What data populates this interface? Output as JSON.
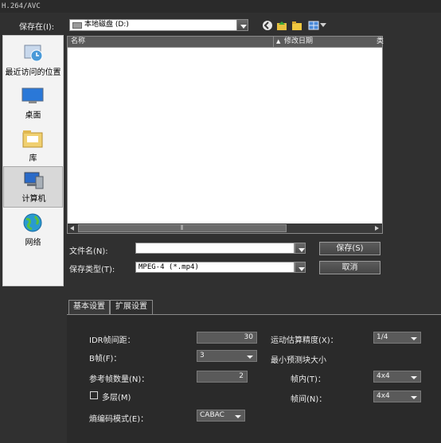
{
  "window": {
    "title": "H.264/AVC"
  },
  "save_in": {
    "label": "保存在(I):",
    "value": "本地磁盘 (D:)"
  },
  "places": [
    {
      "label": "最近访问的位置",
      "icon": "recent-places-icon"
    },
    {
      "label": "桌面",
      "icon": "desktop-icon"
    },
    {
      "label": "库",
      "icon": "libraries-icon"
    },
    {
      "label": "计算机",
      "icon": "computer-icon"
    },
    {
      "label": "网络",
      "icon": "network-icon"
    }
  ],
  "file_list": {
    "columns": [
      "名称",
      "修改日期",
      "类"
    ]
  },
  "filename": {
    "label": "文件名(N):",
    "value": ""
  },
  "filetype": {
    "label": "保存类型(T):",
    "value": "MPEG-4 (*.mp4)"
  },
  "buttons": {
    "save": "保存(S)",
    "cancel": "取消"
  },
  "tabs": [
    "基本设置",
    "扩展设置"
  ],
  "settings": {
    "idr_interval": {
      "label": "IDR帧间距：",
      "value": "30"
    },
    "b_frames": {
      "label": "B帧(F)：",
      "value": "3"
    },
    "ref_frames": {
      "label": "参考帧数量(N)：",
      "value": "2"
    },
    "multilayer": {
      "label": "多层(M)"
    },
    "entropy_mode": {
      "label": "熵编码模式(E)：",
      "value": "CABAC"
    },
    "motion_precision": {
      "label": "运动估算精度(X)：",
      "value": "1/4"
    },
    "min_block": {
      "label": "最小预测块大小"
    },
    "intra": {
      "label": "帧内(T)：",
      "value": "4x4"
    },
    "inter": {
      "label": "帧间(N)：",
      "value": "4x4"
    }
  }
}
